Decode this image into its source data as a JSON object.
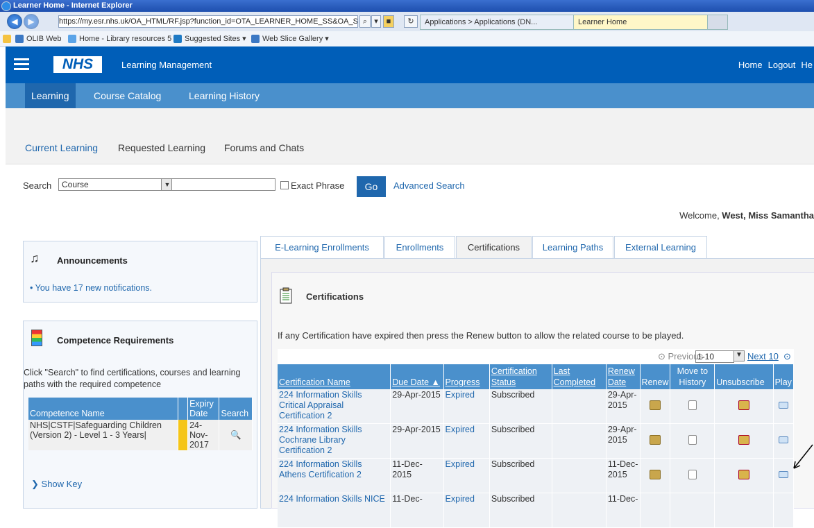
{
  "browser": {
    "title": "Learner Home - Internet Explorer",
    "url": "https://my.esr.nhs.uk/OA_HTML/RF.jsp?function_id=OTA_LEARNER_HOME_SS&OA_SubTab",
    "tabs": [
      "Applications > Applications (DN...",
      "Learner Home"
    ],
    "favorites": [
      "OLIB Web",
      "Home - Library resources 5 ...",
      "Suggested Sites",
      "Web Slice Gallery"
    ]
  },
  "header": {
    "logo": "NHS",
    "title": "Learning Management",
    "links": [
      "Home",
      "Logout",
      "He"
    ]
  },
  "nav": {
    "primary": [
      "Learning",
      "Course Catalog",
      "Learning History"
    ],
    "secondary": [
      "Current Learning",
      "Requested Learning",
      "Forums and Chats"
    ]
  },
  "search": {
    "label": "Search",
    "type_value": "Course",
    "exact_phrase": "Exact Phrase",
    "go": "Go",
    "advanced": "Advanced Search"
  },
  "welcome": {
    "prefix": "Welcome, ",
    "name": "West, Miss Samantha"
  },
  "announcements": {
    "title": "Announcements",
    "note": "You have 17 new notifications."
  },
  "competence": {
    "title": "Competence Requirements",
    "description": "Click \"Search\" to find certifications, courses and learning paths with the required competence",
    "headers": [
      "Competence Name",
      "Expiry Date",
      "Search"
    ],
    "rows": [
      {
        "name": "NHS|CSTF|Safeguarding Children (Version 2) - Level 1 - 3 Years|",
        "expiry": "24-Nov-2017"
      }
    ],
    "show_key": "Show Key"
  },
  "tabs": [
    "E-Learning Enrollments",
    "Enrollments",
    "Certifications",
    "Learning Paths",
    "External Learning"
  ],
  "certifications": {
    "title": "Certifications",
    "note": "If any Certification have expired then press the Renew button to allow the related course to be played.",
    "pager": {
      "previous": "Previous",
      "range": "1-10",
      "next": "Next 10"
    },
    "headers": [
      "Certification Name",
      "Due Date",
      "Progress",
      "Certification Status",
      "Last Completed",
      "Renew Date",
      "Renew",
      "Move to History",
      "Unsubscribe",
      "Play"
    ],
    "rows": [
      {
        "name": "224 Information Skills Critical Appraisal Certification 2",
        "due": "29-Apr-2015",
        "progress": "Expired",
        "status": "Subscribed",
        "last": "",
        "renew_date": "29-Apr-2015"
      },
      {
        "name": "224 Information Skills Cochrane Library Certification 2",
        "due": "29-Apr-2015",
        "progress": "Expired",
        "status": "Subscribed",
        "last": "",
        "renew_date": "29-Apr-2015"
      },
      {
        "name": "224 Information Skills Athens Certification 2",
        "due": "11-Dec-2015",
        "progress": "Expired",
        "status": "Subscribed",
        "last": "",
        "renew_date": "11-Dec-2015"
      },
      {
        "name": "224 Information Skills NICE",
        "due": "11-Dec-",
        "progress": "Expired",
        "status": "Subscribed",
        "last": "",
        "renew_date": "11-Dec-"
      }
    ]
  },
  "colors": {
    "nhs_blue": "#005eb8",
    "nav_blue": "#4a90cc",
    "link": "#1f67ad"
  }
}
